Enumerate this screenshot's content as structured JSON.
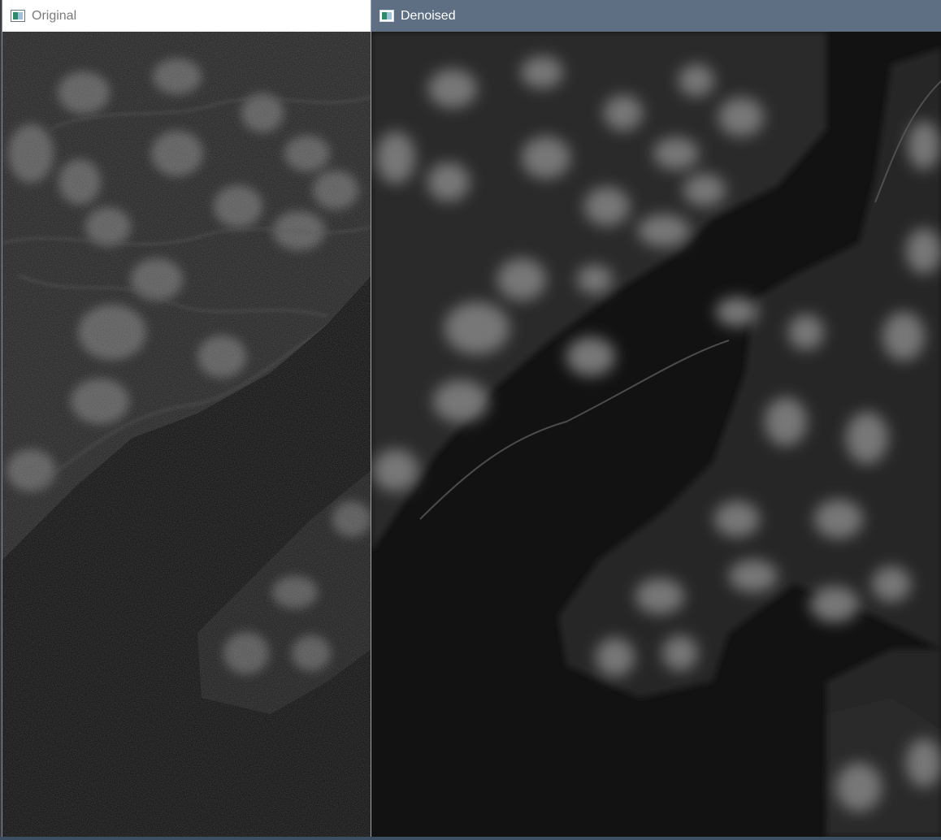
{
  "windows": [
    {
      "title": "Original",
      "state": "inactive",
      "icon": "image-window-icon",
      "content": "noisy fluorescence microscopy image of cells"
    },
    {
      "title": "Denoised",
      "state": "active",
      "icon": "image-window-icon",
      "content": "denoised fluorescence microscopy image of cells"
    }
  ],
  "colors": {
    "inactive_titlebar": "#ffffff",
    "active_titlebar": "#5e6f83",
    "image_background": "#121212"
  }
}
